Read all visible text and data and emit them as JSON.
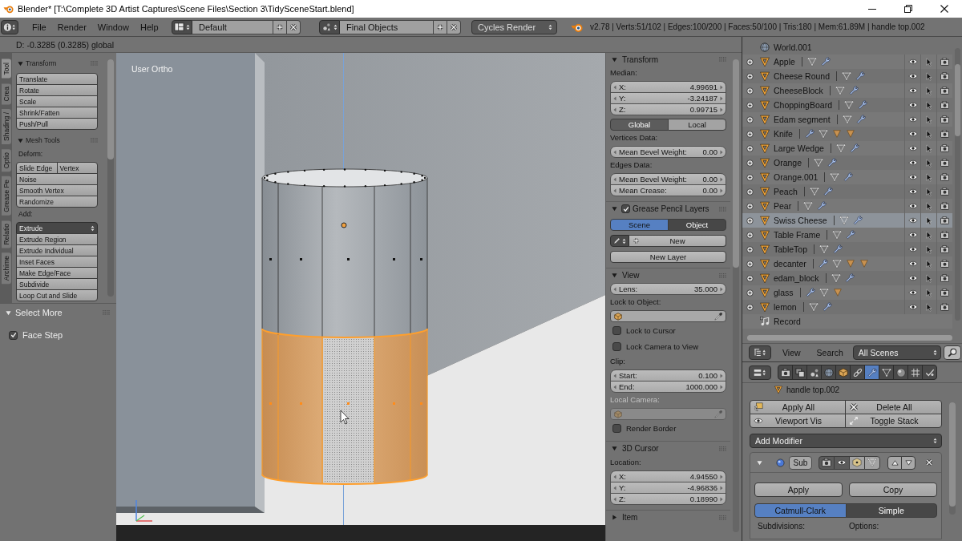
{
  "window": {
    "title": "Blender* [T:\\Complete 3D Artist Captures\\Scene Files\\Section 3\\TidySceneStart.blend]"
  },
  "info_header": {
    "menus": [
      "File",
      "Render",
      "Window",
      "Help"
    ],
    "screen_layout": "Default",
    "scene": "Final Objects",
    "render_engine": "Cycles Render",
    "stats": "v2.78 | Verts:51/102 | Edges:100/200 | Faces:50/100 | Tris:180 | Mem:61.89M | handle top.002"
  },
  "viewport": {
    "header_text": "D: -0.3285 (0.3285) global",
    "view_label": "User Ortho"
  },
  "tool_shelf": {
    "tabs": [
      {
        "label": "Tool",
        "selected": true
      },
      {
        "label": "Crea",
        "selected": false
      },
      {
        "label": "Shading /",
        "selected": false
      },
      {
        "label": "Optio",
        "selected": false
      },
      {
        "label": "Grease Pe",
        "selected": false
      },
      {
        "label": "Relatio",
        "selected": false
      },
      {
        "label": "Archime",
        "selected": false
      }
    ],
    "panels": [
      {
        "title": "Transform",
        "expanded": true,
        "rows": [
          {
            "kind": "button",
            "labels": [
              "Translate"
            ]
          },
          {
            "kind": "button",
            "labels": [
              "Rotate"
            ]
          },
          {
            "kind": "button",
            "labels": [
              "Scale"
            ]
          },
          {
            "kind": "button",
            "labels": [
              "Shrink/Fatten"
            ]
          },
          {
            "kind": "button",
            "labels": [
              "Push/Pull"
            ]
          }
        ]
      },
      {
        "title": "Mesh Tools",
        "expanded": true,
        "rows": [
          {
            "kind": "label",
            "text": "Deform:"
          },
          {
            "kind": "button",
            "labels": [
              "Slide Edge",
              "Vertex"
            ]
          },
          {
            "kind": "button",
            "labels": [
              "Noise"
            ]
          },
          {
            "kind": "button",
            "labels": [
              "Smooth Vertex"
            ]
          },
          {
            "kind": "button",
            "labels": [
              "Randomize"
            ]
          },
          {
            "kind": "label",
            "text": "Add:"
          },
          {
            "kind": "dropdown",
            "text": "Extrude"
          },
          {
            "kind": "button",
            "labels": [
              "Extrude Region"
            ]
          },
          {
            "kind": "button",
            "labels": [
              "Extrude Individual"
            ]
          },
          {
            "kind": "button",
            "labels": [
              "Inset Faces"
            ]
          },
          {
            "kind": "button",
            "labels": [
              "Make Edge/Face"
            ]
          },
          {
            "kind": "button",
            "labels": [
              "Subdivide"
            ]
          },
          {
            "kind": "button",
            "labels": [
              "Loop Cut and Slide"
            ]
          }
        ]
      }
    ]
  },
  "operator_panel": {
    "title": "Select More",
    "expanded": true,
    "options": [
      {
        "label": "Face Step",
        "checked": true
      }
    ]
  },
  "n_panel": {
    "panels": [
      {
        "title": "Transform",
        "kind": "plain",
        "expanded": true,
        "rows": [
          {
            "kind": "label",
            "text": "Median:",
            "disabled": false
          },
          {
            "kind": "number",
            "label": "X:",
            "value": "4.99691"
          },
          {
            "kind": "number",
            "label": "Y:",
            "value": "-3.24187"
          },
          {
            "kind": "number",
            "label": "Z:",
            "value": "0.99715"
          },
          {
            "kind": "toggle",
            "options": [
              {
                "label": "Global",
                "selected": true
              },
              {
                "label": "Local",
                "selected": false
              }
            ]
          },
          {
            "kind": "label",
            "text": "Vertices Data:",
            "disabled": false
          },
          {
            "kind": "number",
            "label": "Mean Bevel Weight:",
            "value": "0.00"
          },
          {
            "kind": "label",
            "text": "Edges Data:",
            "disabled": false
          },
          {
            "kind": "number",
            "label": "Mean Bevel Weight:",
            "value": "0.00"
          },
          {
            "kind": "number",
            "label": "Mean Crease:",
            "value": "0.00"
          }
        ]
      },
      {
        "title": "Grease Pencil Layers",
        "kind": "checkbox",
        "checked": true,
        "expanded": true,
        "rows": [
          {
            "kind": "radio",
            "options": [
              {
                "label": "Scene",
                "selected": true
              },
              {
                "label": "Object",
                "selected": false
              }
            ]
          },
          {
            "kind": "new_datablock",
            "text": "New"
          },
          {
            "kind": "button",
            "text": "New Layer"
          }
        ]
      },
      {
        "title": "View",
        "kind": "plain",
        "expanded": true,
        "rows": [
          {
            "kind": "number",
            "label": "Lens:",
            "value": "35.000"
          },
          {
            "kind": "label",
            "text": "Lock to Object:",
            "disabled": false
          },
          {
            "kind": "object_field",
            "disabled": false
          },
          {
            "kind": "checkbox",
            "text": "Lock to Cursor",
            "checked": false
          },
          {
            "kind": "checkbox",
            "text": "Lock Camera to View",
            "checked": false
          },
          {
            "kind": "label",
            "text": "Clip:",
            "disabled": false
          },
          {
            "kind": "number",
            "label": "Start:",
            "value": "0.100"
          },
          {
            "kind": "number",
            "label": "End:",
            "value": "1000.000"
          },
          {
            "kind": "label",
            "text": "Local Camera:",
            "disabled": true
          },
          {
            "kind": "object_field",
            "disabled": true
          },
          {
            "kind": "checkbox",
            "text": "Render Border",
            "checked": false
          }
        ]
      },
      {
        "title": "3D Cursor",
        "kind": "plain",
        "expanded": true,
        "rows": [
          {
            "kind": "label",
            "text": "Location:",
            "disabled": false
          },
          {
            "kind": "number",
            "label": "X:",
            "value": "4.94550"
          },
          {
            "kind": "number",
            "label": "Y:",
            "value": "-4.96836"
          },
          {
            "kind": "number",
            "label": "Z:",
            "value": "0.18990"
          }
        ]
      },
      {
        "title": "Item",
        "kind": "plain",
        "expanded": false
      }
    ]
  },
  "outliner": {
    "items": [
      {
        "kind": "world",
        "name": "World.001",
        "selected": false
      },
      {
        "kind": "mesh_object",
        "name": "Apple",
        "selected": false,
        "data_icons": [
          {
            "kind": "mesh_data"
          },
          {
            "kind": "modifiers"
          }
        ]
      },
      {
        "kind": "mesh_object",
        "name": "Cheese Round",
        "selected": false,
        "data_icons": [
          {
            "kind": "mesh_data"
          },
          {
            "kind": "modifiers"
          }
        ]
      },
      {
        "kind": "mesh_object",
        "name": "CheeseBlock",
        "selected": false,
        "data_icons": [
          {
            "kind": "mesh_data"
          },
          {
            "kind": "modifiers"
          }
        ]
      },
      {
        "kind": "mesh_object",
        "name": "ChoppingBoard",
        "selected": false,
        "data_icons": [
          {
            "kind": "mesh_data"
          },
          {
            "kind": "modifiers"
          }
        ]
      },
      {
        "kind": "mesh_object",
        "name": "Edam segment",
        "selected": false,
        "data_icons": [
          {
            "kind": "mesh_data"
          },
          {
            "kind": "modifiers"
          }
        ]
      },
      {
        "kind": "mesh_object",
        "name": "Knife",
        "selected": false,
        "data_icons": [
          {
            "kind": "modifiers"
          },
          {
            "kind": "mesh_data"
          },
          {
            "kind": "child_object"
          },
          {
            "kind": "child_object"
          }
        ]
      },
      {
        "kind": "mesh_object",
        "name": "Large Wedge",
        "selected": false,
        "data_icons": [
          {
            "kind": "mesh_data"
          },
          {
            "kind": "modifiers"
          }
        ]
      },
      {
        "kind": "mesh_object",
        "name": "Orange",
        "selected": false,
        "data_icons": [
          {
            "kind": "mesh_data"
          },
          {
            "kind": "modifiers"
          }
        ]
      },
      {
        "kind": "mesh_object",
        "name": "Orange.001",
        "selected": false,
        "data_icons": [
          {
            "kind": "mesh_data"
          },
          {
            "kind": "modifiers"
          }
        ]
      },
      {
        "kind": "mesh_object",
        "name": "Peach",
        "selected": false,
        "data_icons": [
          {
            "kind": "mesh_data"
          },
          {
            "kind": "modifiers"
          }
        ]
      },
      {
        "kind": "mesh_object",
        "name": "Pear",
        "selected": false,
        "data_icons": [
          {
            "kind": "mesh_data"
          },
          {
            "kind": "modifiers"
          }
        ]
      },
      {
        "kind": "mesh_object",
        "name": "Swiss Cheese",
        "selected": true,
        "data_icons": [
          {
            "kind": "mesh_data"
          },
          {
            "kind": "modifiers"
          }
        ]
      },
      {
        "kind": "mesh_object",
        "name": "Table Frame",
        "selected": false,
        "data_icons": [
          {
            "kind": "mesh_data"
          },
          {
            "kind": "modifiers"
          }
        ]
      },
      {
        "kind": "mesh_object",
        "name": "TableTop",
        "selected": false,
        "data_icons": [
          {
            "kind": "mesh_data"
          },
          {
            "kind": "modifiers"
          }
        ]
      },
      {
        "kind": "mesh_object",
        "name": "decanter",
        "selected": false,
        "data_icons": [
          {
            "kind": "modifiers"
          },
          {
            "kind": "mesh_data"
          },
          {
            "kind": "child_object"
          },
          {
            "kind": "child_object"
          }
        ]
      },
      {
        "kind": "mesh_object",
        "name": "edam_block",
        "selected": false,
        "data_icons": [
          {
            "kind": "mesh_data"
          },
          {
            "kind": "modifiers"
          }
        ]
      },
      {
        "kind": "mesh_object",
        "name": "glass",
        "selected": false,
        "data_icons": [
          {
            "kind": "modifiers"
          },
          {
            "kind": "mesh_data"
          },
          {
            "kind": "child_object"
          }
        ]
      },
      {
        "kind": "mesh_object",
        "name": "lemon",
        "selected": false,
        "data_icons": [
          {
            "kind": "mesh_data"
          },
          {
            "kind": "modifiers"
          }
        ]
      },
      {
        "kind": "speaker",
        "name": "Record",
        "selected": false
      }
    ],
    "header": {
      "menus": [
        "View",
        "Search"
      ],
      "filter": "All Scenes"
    }
  },
  "properties": {
    "tabs": [
      {
        "kind": "render",
        "selected": false
      },
      {
        "kind": "render_layers",
        "selected": false
      },
      {
        "kind": "scene",
        "selected": false
      },
      {
        "kind": "world",
        "selected": false
      },
      {
        "kind": "object",
        "selected": false
      },
      {
        "kind": "constraints",
        "selected": false
      },
      {
        "kind": "modifiers",
        "selected": true
      },
      {
        "kind": "data",
        "selected": false
      },
      {
        "kind": "material",
        "selected": false
      },
      {
        "kind": "particles",
        "selected": false
      },
      {
        "kind": "physics",
        "selected": false
      }
    ],
    "breadcrumb": "handle top.002",
    "actions": [
      {
        "kind": "apply_all",
        "label": "Apply All"
      },
      {
        "kind": "delete_all",
        "label": "Delete All"
      },
      {
        "kind": "viewport_vis",
        "label": "Viewport Vis"
      },
      {
        "kind": "toggle_stack",
        "label": "Toggle Stack"
      }
    ],
    "add_modifier": "Add Modifier",
    "modifier": {
      "expanded": true,
      "name": "Sub",
      "toggles": [
        {
          "kind": "render",
          "on": true
        },
        {
          "kind": "realtime",
          "on": true
        },
        {
          "kind": "edit_mode",
          "on": false
        },
        {
          "kind": "on_cage",
          "on": false
        }
      ],
      "buttons": [
        "Apply",
        "Copy"
      ],
      "subdivision_type": [
        {
          "label": "Catmull-Clark",
          "selected": true
        },
        {
          "label": "Simple",
          "selected": false
        }
      ],
      "labels": [
        "Subdivisions:",
        "Options:"
      ]
    }
  }
}
